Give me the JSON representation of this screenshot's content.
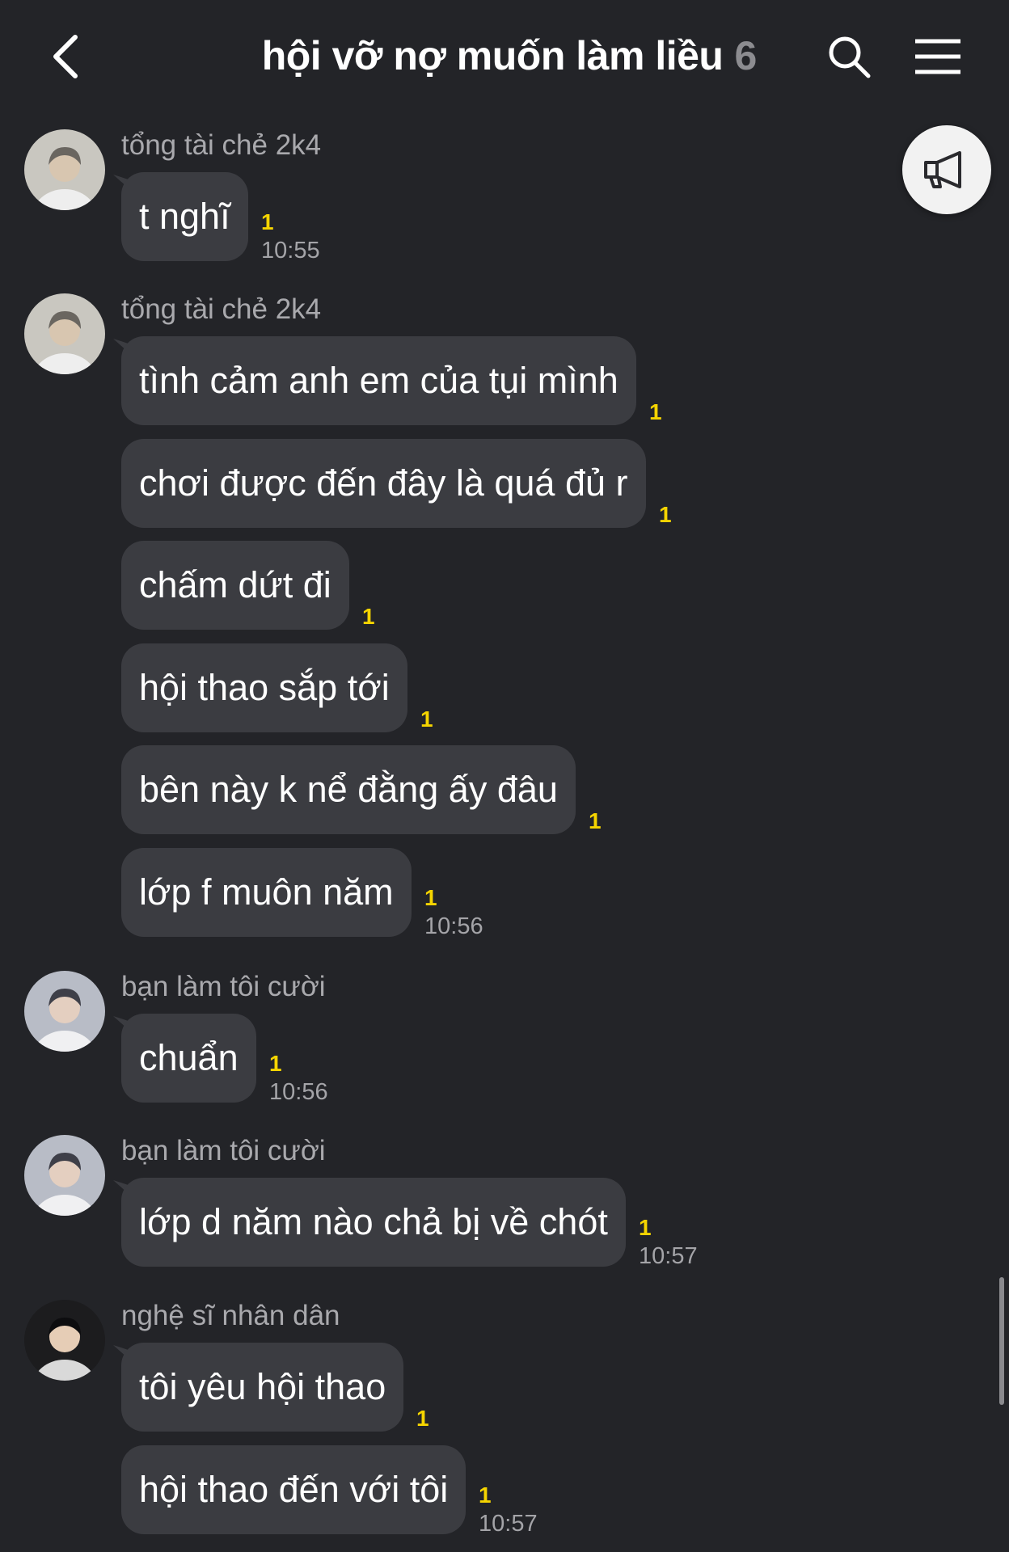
{
  "header": {
    "title": "hội vỡ nợ muốn làm liều",
    "member_count": "6"
  },
  "messages": [
    {
      "sender": "tổng tài chẻ 2k4",
      "bubbles": [
        {
          "text": "t nghĩ",
          "unread": "1",
          "time": "10:55"
        }
      ]
    },
    {
      "sender": "tổng tài chẻ 2k4",
      "bubbles": [
        {
          "text": "tình cảm anh em của tụi mình",
          "unread": "1"
        },
        {
          "text": "chơi được đến đây là quá đủ r",
          "unread": "1"
        },
        {
          "text": "chấm dứt đi",
          "unread": "1"
        },
        {
          "text": "hội thao sắp tới",
          "unread": "1"
        },
        {
          "text": "bên này k nể đằng ấy đâu",
          "unread": "1"
        },
        {
          "text": "lớp f muôn năm",
          "unread": "1",
          "time": "10:56"
        }
      ]
    },
    {
      "sender": "bạn làm tôi cười",
      "bubbles": [
        {
          "text": "chuẩn",
          "unread": "1",
          "time": "10:56"
        }
      ]
    },
    {
      "sender": "bạn làm tôi cười",
      "bubbles": [
        {
          "text": "lớp d năm nào chả bị về chót",
          "unread": "1",
          "time": "10:57"
        }
      ]
    },
    {
      "sender": "nghệ sĩ nhân dân",
      "bubbles": [
        {
          "text": "tôi yêu hội thao",
          "unread": "1"
        },
        {
          "text": "hội thao đến với tôi",
          "unread": "1",
          "time": "10:57"
        }
      ]
    }
  ],
  "colors": {
    "background": "#232428",
    "bubble": "#3b3c41",
    "unread": "#f5d400",
    "meta_text": "#a4a4a8"
  },
  "icons": {
    "back": "chevron-left-icon",
    "search": "search-icon",
    "menu": "hamburger-menu-icon",
    "announcement": "megaphone-icon"
  }
}
